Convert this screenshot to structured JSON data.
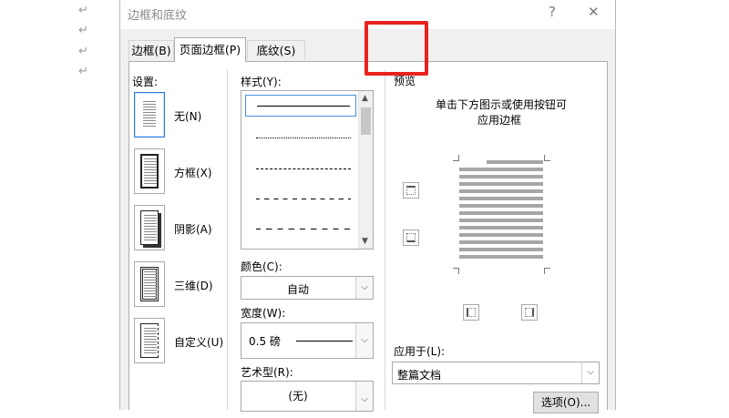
{
  "document": {
    "para_marks": [
      "↵",
      "↵",
      "↵",
      "↵"
    ]
  },
  "dialog": {
    "title": "边框和底纹",
    "help": "?",
    "close": "✕",
    "tabs": [
      {
        "label": "边框(B)",
        "active": false
      },
      {
        "label": "页面边框(P)",
        "active": true
      },
      {
        "label": "底纹(S)",
        "active": false
      }
    ],
    "settings": {
      "heading": "设置:",
      "items": [
        {
          "label": "无(N)",
          "selected": true
        },
        {
          "label": "方框(X)",
          "selected": false
        },
        {
          "label": "阴影(A)",
          "selected": false
        },
        {
          "label": "三维(D)",
          "selected": false
        },
        {
          "label": "自定义(U)",
          "selected": false
        }
      ]
    },
    "style": {
      "heading": "样式(Y):",
      "items": [
        "solid",
        "dotted",
        "dashed-small",
        "dashed",
        "dash-dot"
      ]
    },
    "color": {
      "label": "颜色(C):",
      "value": "自动"
    },
    "width": {
      "label": "宽度(W):",
      "value": "0.5 磅"
    },
    "art": {
      "label": "艺术型(R):",
      "value": "(无)"
    },
    "preview": {
      "heading": "预览",
      "hint_line1": "单击下方图示或使用按钮可",
      "hint_line2": "应用边框"
    },
    "apply_to": {
      "label": "应用于(L):",
      "value": "整篇文档"
    },
    "options_button": "选项(O)...",
    "colors": {
      "highlight": "#e8221e",
      "selection": "#2c7ad6"
    }
  }
}
